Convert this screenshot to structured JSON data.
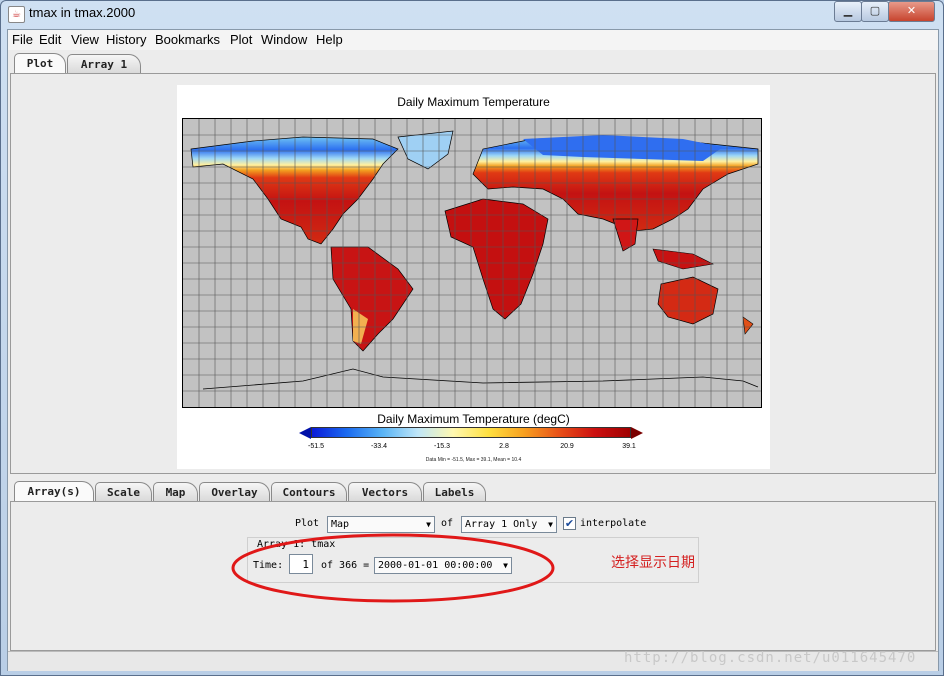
{
  "window": {
    "title": "tmax in tmax.2000",
    "app_icon": "java-cup-icon",
    "buttons": [
      "minimize",
      "maximize",
      "close"
    ]
  },
  "menu": [
    "File",
    "Edit",
    "View",
    "History",
    "Bookmarks",
    "Plot",
    "Window",
    "Help"
  ],
  "top_tabs": [
    {
      "label": "Plot",
      "active": true
    },
    {
      "label": "Array 1",
      "active": false
    }
  ],
  "plot": {
    "title": "Daily Maximum Temperature",
    "colorbar_title": "Daily Maximum Temperature (degC)",
    "colorbar_ticks": [
      "-51.5",
      "-33.4",
      "-15.3",
      "2.8",
      "20.9",
      "39.1"
    ],
    "stats": "Data Min = -51.5, Max = 39.1, Mean = 10.4",
    "colors": {
      "cold": "#0a1ad8",
      "mid": "#fff8b0",
      "hot": "#a00000",
      "land_missing": "#c2c2c2"
    }
  },
  "bottom_tabs": [
    {
      "label": "Array(s)",
      "active": true
    },
    {
      "label": "Scale",
      "active": false
    },
    {
      "label": "Map",
      "active": false
    },
    {
      "label": "Overlay",
      "active": false
    },
    {
      "label": "Contours",
      "active": false
    },
    {
      "label": "Vectors",
      "active": false
    },
    {
      "label": "Labels",
      "active": false
    }
  ],
  "controls": {
    "plot_label": "Plot",
    "plot_type": "Map",
    "of_label": "of",
    "array_choice": "Array 1 Only",
    "interpolate_checked": true,
    "interpolate_label": "interpolate",
    "group_title": "Array 1: tmax",
    "time_label": "Time:",
    "time_index": "1",
    "of_total": "of 366 =",
    "time_value": "2000-01-01 00:00:00"
  },
  "annotation": {
    "text": "选择显示日期",
    "color": "#d42020"
  },
  "watermark": "http://blog.csdn.net/u011645470"
}
